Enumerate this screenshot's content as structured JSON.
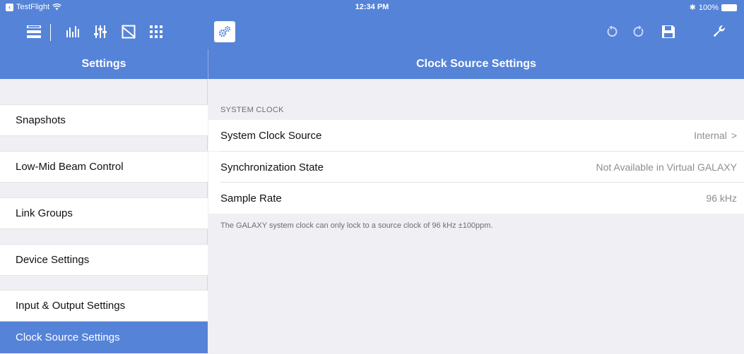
{
  "status_bar": {
    "back_app": "TestFlight",
    "time": "12:34 PM",
    "bluetooth": "✱",
    "battery": "100%"
  },
  "toolbar": {
    "icons": [
      "list-icon",
      "channel-meters-icon",
      "faders-icon",
      "eq-icon",
      "grid-icon",
      "settings-gears-icon",
      "undo-icon",
      "redo-icon",
      "save-icon",
      "wrench-icon"
    ]
  },
  "left_pane": {
    "title": "Settings",
    "items": [
      {
        "label": "Snapshots"
      },
      {
        "label": "Low-Mid Beam Control"
      },
      {
        "label": "Link Groups"
      },
      {
        "label": "Device Settings"
      },
      {
        "label": "Input & Output Settings"
      },
      {
        "label": "Clock Source Settings",
        "selected": true
      }
    ]
  },
  "right_pane": {
    "title": "Clock Source Settings",
    "section_header": "SYSTEM CLOCK",
    "rows": [
      {
        "label": "System Clock Source",
        "value": "Internal",
        "chevron": ">"
      },
      {
        "label": "Synchronization State",
        "value": "Not Available in Virtual GALAXY"
      },
      {
        "label": "Sample Rate",
        "value": "96 kHz"
      }
    ],
    "footer": "The GALAXY system clock can only lock to a source clock of 96 kHz ±100ppm."
  },
  "colors": {
    "accent": "#5583d8",
    "background": "#efeff4"
  }
}
